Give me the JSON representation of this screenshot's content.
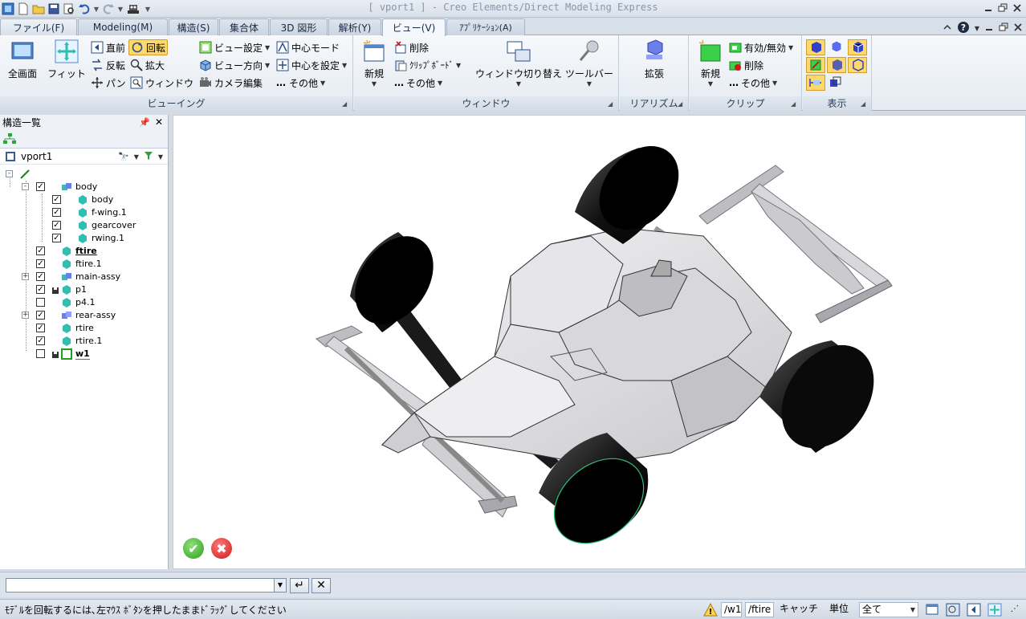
{
  "window": {
    "title": "[ vport1 ] - Creo Elements/Direct Modeling Express"
  },
  "quick_access": {
    "icons": [
      "app-icon",
      "new-icon",
      "open-icon",
      "save-icon",
      "print-preview-icon",
      "undo-icon",
      "redo-icon",
      "robot-icon"
    ]
  },
  "tabs": [
    {
      "label": "ファイル(F)"
    },
    {
      "label": "Modeling(M)"
    },
    {
      "label": "構造(S)"
    },
    {
      "label": "集合体"
    },
    {
      "label": "3D 図形"
    },
    {
      "label": "解析(Y)"
    },
    {
      "label": "ビュー(V)"
    },
    {
      "label": "ｱﾌﾟﾘｹｰｼｮﾝ(A)"
    }
  ],
  "ribbon": {
    "viewing": {
      "label": "ビューイング",
      "full": "全画面",
      "fit": "フィット",
      "direct": "直前",
      "reverse": "反転",
      "pan": "パン",
      "rotate": "回転",
      "zoom": "拡大",
      "window": "ウィンドウ",
      "view_settings": "ビュー設定",
      "view_direction": "ビュー方向",
      "camera_edit": "カメラ編集",
      "center_mode": "中心モード",
      "set_center": "中心を設定",
      "other": "その他"
    },
    "window": {
      "label": "ウィンドウ",
      "new": "新規",
      "delete": "削除",
      "clipboard": "ｸﾘｯﾌﾟﾎﾞｰﾄﾞ",
      "other": "その他",
      "switch": "ウィンドウ切り替え",
      "toolbar": "ツールバー"
    },
    "realism": {
      "label": "リアリズム",
      "expand": "拡張"
    },
    "clip": {
      "label": "クリップ",
      "new": "新規",
      "toggle": "有効/無効",
      "delete": "削除",
      "other": "その他"
    },
    "display": {
      "label": "表示"
    }
  },
  "panel": {
    "title": "構造一覧",
    "root": "vport1",
    "tree": [
      {
        "label": "",
        "level": 0,
        "icon": "pencil-icon",
        "checked": null,
        "expander": "-"
      },
      {
        "label": "body",
        "level": 1,
        "icon": "assembly-icon",
        "checked": true,
        "expander": "-"
      },
      {
        "label": "body",
        "level": 2,
        "icon": "part-icon",
        "checked": true,
        "expander": ""
      },
      {
        "label": "f-wing.1",
        "level": 2,
        "icon": "part-icon",
        "checked": true,
        "expander": ""
      },
      {
        "label": "gearcover",
        "level": 2,
        "icon": "part-icon",
        "checked": true,
        "expander": ""
      },
      {
        "label": "rwing.1",
        "level": 2,
        "icon": "part-icon",
        "checked": true,
        "expander": ""
      },
      {
        "label": "ftire",
        "level": 1,
        "icon": "part-icon",
        "checked": true,
        "expander": "",
        "bold": true
      },
      {
        "label": "ftire.1",
        "level": 1,
        "icon": "part-icon",
        "checked": true,
        "expander": ""
      },
      {
        "label": "main-assy",
        "level": 1,
        "icon": "assembly-icon",
        "checked": true,
        "expander": "+"
      },
      {
        "label": "p1",
        "level": 1,
        "icon": "part-icon",
        "checked": true,
        "expander": "",
        "saved": true
      },
      {
        "label": "p4.1",
        "level": 1,
        "icon": "part-icon",
        "checked": false,
        "expander": ""
      },
      {
        "label": "rear-assy",
        "level": 1,
        "icon": "assembly-icon",
        "checked": true,
        "expander": "+"
      },
      {
        "label": "rtire",
        "level": 1,
        "icon": "part-icon",
        "checked": true,
        "expander": ""
      },
      {
        "label": "rtire.1",
        "level": 1,
        "icon": "part-icon",
        "checked": true,
        "expander": ""
      },
      {
        "label": "w1",
        "level": 1,
        "icon": "workplane-icon",
        "checked": false,
        "expander": "",
        "saved": true,
        "bold": true
      }
    ]
  },
  "viewport": {
    "model": "f1-car-model"
  },
  "cmdline": {
    "value": ""
  },
  "status": {
    "message": "ﾓﾃﾞﾙを回転するには､左ﾏｳｽ ﾎﾞﾀﾝを押したままﾄﾞﾗｯｸﾞしてください",
    "workplane": "/w1",
    "part": "/ftire",
    "catch": "キャッチ",
    "unit": "単位",
    "filter": "全て"
  },
  "colors": {
    "accent": "#ffd86b",
    "tree_part": "#2fbfb0",
    "ok": "#2f9d1f",
    "cancel": "#d01818"
  }
}
